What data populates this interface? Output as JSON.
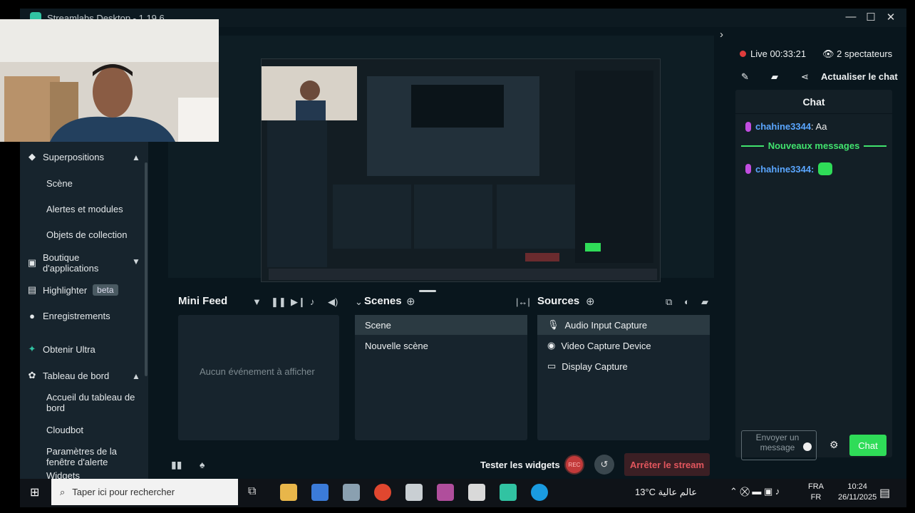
{
  "window": {
    "title": "Streamlabs Desktop - 1.19.6"
  },
  "sidebar": {
    "items": [
      {
        "label": "Superpositions"
      },
      {
        "label": "Scène"
      },
      {
        "label": "Alertes et modules"
      },
      {
        "label": "Objets de collection"
      },
      {
        "label": "Boutique d'applications"
      },
      {
        "label": "Highlighter",
        "badge": "beta"
      },
      {
        "label": "Enregistrements"
      },
      {
        "label": "Obtenir Ultra"
      },
      {
        "label": "Tableau de bord"
      },
      {
        "label": "Accueil du tableau de bord"
      },
      {
        "label": "Cloudbot"
      },
      {
        "label": "Paramètres de la fenêtre d'alerte"
      },
      {
        "label": "Widgets"
      }
    ]
  },
  "minifeed": {
    "title": "Mini Feed",
    "empty": "Aucun événement à afficher"
  },
  "scenes": {
    "title": "Scenes",
    "items": [
      "Scene",
      "Nouvelle scène"
    ],
    "selected": 0
  },
  "sources": {
    "title": "Sources",
    "items": [
      {
        "label": "Audio Input Capture",
        "icon": "mic-icon"
      },
      {
        "label": "Video Capture Device",
        "icon": "webcam-icon"
      },
      {
        "label": "Display Capture",
        "icon": "monitor-icon"
      }
    ],
    "selected": 0
  },
  "bottom": {
    "test_widgets": "Tester les widgets",
    "rec": "REC",
    "stop": "Arrêter le stream"
  },
  "status": {
    "live": "Live 00:33:21",
    "viewers": "2 spectateurs",
    "refresh_chat": "Actualiser le chat"
  },
  "chat": {
    "title": "Chat",
    "messages": [
      {
        "user": "chahine3344",
        "text": ": Aa"
      },
      {
        "user": "chahine3344",
        "text": ":"
      }
    ],
    "new_messages": "Nouveaux messages",
    "input_placeholder": "Envoyer un message",
    "send": "Chat"
  },
  "taskbar": {
    "search": "Taper ici pour rechercher",
    "weather": "13°C عالم عالية",
    "lang1": "FRA",
    "lang2": "FR",
    "time": "10:24",
    "date": "26/11/2025"
  },
  "colors": {
    "accent": "#31c3a2",
    "live": "#e03c3c",
    "chat_green": "#2fdc58",
    "username": "#5aa6ff",
    "stop": "#e2565d"
  }
}
